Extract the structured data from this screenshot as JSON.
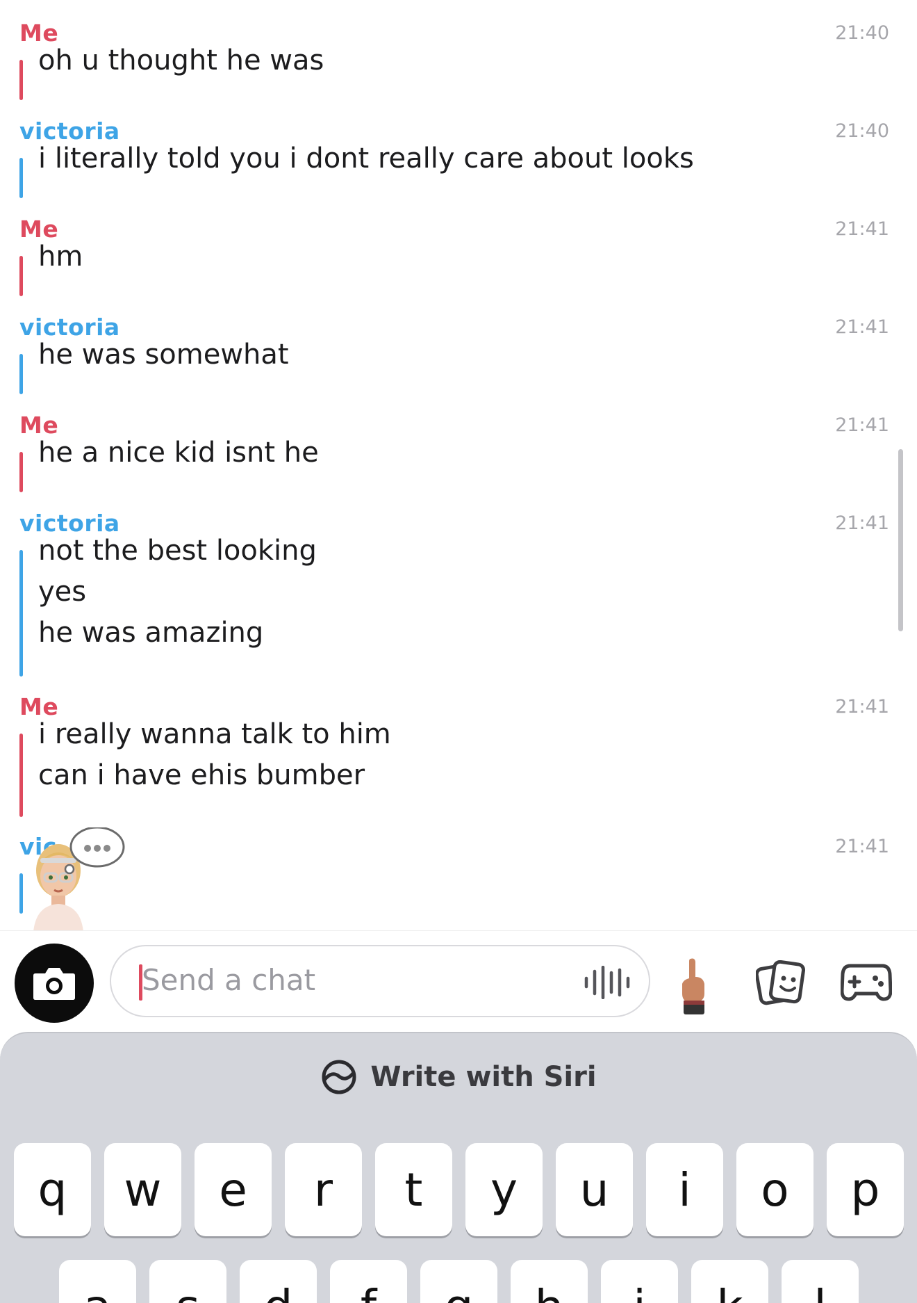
{
  "messages": [
    {
      "sender": "Me",
      "side": "me",
      "time": "21:40",
      "lines": [
        "oh u thought he was"
      ]
    },
    {
      "sender": "victoria",
      "side": "them",
      "time": "21:40",
      "lines": [
        "i literally told you i dont really care about looks"
      ]
    },
    {
      "sender": "Me",
      "side": "me",
      "time": "21:41",
      "lines": [
        "hm"
      ]
    },
    {
      "sender": "victoria",
      "side": "them",
      "time": "21:41",
      "lines": [
        "he was somewhat"
      ]
    },
    {
      "sender": "Me",
      "side": "me",
      "time": "21:41",
      "lines": [
        "he a nice kid isnt he"
      ]
    },
    {
      "sender": "victoria",
      "side": "them",
      "time": "21:41",
      "lines": [
        "not the best looking",
        "yes",
        "he was amazing"
      ]
    },
    {
      "sender": "Me",
      "side": "me",
      "time": "21:41",
      "lines": [
        "i really wanna talk to him",
        "can i have ehis bumber"
      ]
    },
    {
      "sender": "vic",
      "side": "them",
      "time": "21:41",
      "lines": []
    }
  ],
  "composer": {
    "placeholder": "Send a chat",
    "icons": [
      "camera-icon",
      "voice-icon",
      "finger-icon",
      "sticker-icon",
      "game-controller-icon"
    ]
  },
  "keyboard": {
    "siri_label": "Write with Siri",
    "row1": [
      "q",
      "w",
      "e",
      "r",
      "t",
      "y",
      "u",
      "i",
      "o",
      "p"
    ],
    "row2": [
      "a",
      "s",
      "d",
      "f",
      "g",
      "h",
      "j",
      "k",
      "l"
    ]
  },
  "colors": {
    "me": "#de4a5e",
    "them": "#3ea4e6",
    "time": "#a6a6ab",
    "keyboard_bg": "#d4d6dc"
  }
}
